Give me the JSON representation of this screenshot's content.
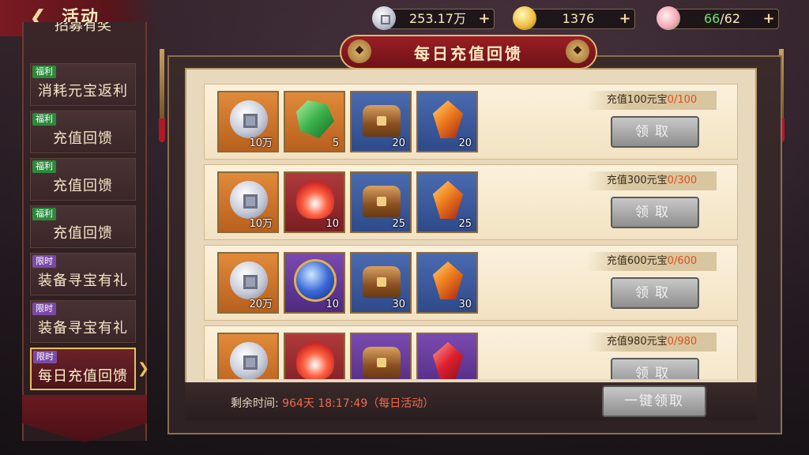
{
  "header": {
    "back_icon": "back-arrow-icon",
    "title": "活动"
  },
  "resources": [
    {
      "icon": "silver-coin-icon",
      "value": "253.17万"
    },
    {
      "icon": "gold-ingot-icon",
      "value": "1376"
    },
    {
      "icon": "peach-icon",
      "value_current": "66",
      "value_max": "/62"
    }
  ],
  "sidebar": {
    "partial_top_label": "招募有奖",
    "items": [
      {
        "tag": "福利",
        "label": "消耗元宝返利",
        "active": false
      },
      {
        "tag": "福利",
        "label": "充值回馈",
        "active": false
      },
      {
        "tag": "福利",
        "label": "充值回馈",
        "active": false
      },
      {
        "tag": "福利",
        "label": "充值回馈",
        "active": false
      },
      {
        "tag": "限时",
        "label": "装备寻宝有礼",
        "active": false
      },
      {
        "tag": "限时",
        "label": "装备寻宝有礼",
        "active": false
      },
      {
        "tag": "限时",
        "label": "每日充值回馈",
        "active": true
      }
    ]
  },
  "panel": {
    "title": "每日充值回馈"
  },
  "rewards": [
    {
      "condition": "充值100元宝",
      "progress": "0/100",
      "button": "领取",
      "items": [
        {
          "icon": "silver-coin-icon",
          "qty": "10万",
          "rarity": "orange"
        },
        {
          "icon": "emerald-icon",
          "qty": "5",
          "rarity": "orange"
        },
        {
          "icon": "treasure-chest-icon",
          "qty": "20",
          "rarity": "blue"
        },
        {
          "icon": "crystal-icon",
          "qty": "20",
          "rarity": "blue"
        }
      ]
    },
    {
      "condition": "充值300元宝",
      "progress": "0/300",
      "button": "领取",
      "items": [
        {
          "icon": "silver-coin-icon",
          "qty": "10万",
          "rarity": "orange"
        },
        {
          "icon": "flame-talisman-icon",
          "qty": "10",
          "rarity": "red"
        },
        {
          "icon": "treasure-chest-icon",
          "qty": "25",
          "rarity": "blue"
        },
        {
          "icon": "crystal-icon",
          "qty": "25",
          "rarity": "blue"
        }
      ]
    },
    {
      "condition": "充值600元宝",
      "progress": "0/600",
      "button": "领取",
      "items": [
        {
          "icon": "silver-coin-icon",
          "qty": "20万",
          "rarity": "orange"
        },
        {
          "icon": "astral-orb-icon",
          "qty": "10",
          "rarity": "purple"
        },
        {
          "icon": "treasure-chest-icon",
          "qty": "30",
          "rarity": "blue"
        },
        {
          "icon": "crystal-icon",
          "qty": "30",
          "rarity": "blue"
        }
      ]
    },
    {
      "condition": "充值980元宝",
      "progress": "0/980",
      "button": "领取",
      "items": [
        {
          "icon": "silver-coin-icon",
          "qty": "",
          "rarity": "orange"
        },
        {
          "icon": "flame-talisman-icon",
          "qty": "",
          "rarity": "red"
        },
        {
          "icon": "treasure-chest-icon",
          "qty": "",
          "rarity": "purple"
        },
        {
          "icon": "ruby-icon",
          "qty": "",
          "rarity": "purple"
        }
      ]
    }
  ],
  "footer": {
    "timer_label": "剩余时间:",
    "timer_value": "964天 18:17:49（每日活动）",
    "onekey_button": "一键领取"
  }
}
